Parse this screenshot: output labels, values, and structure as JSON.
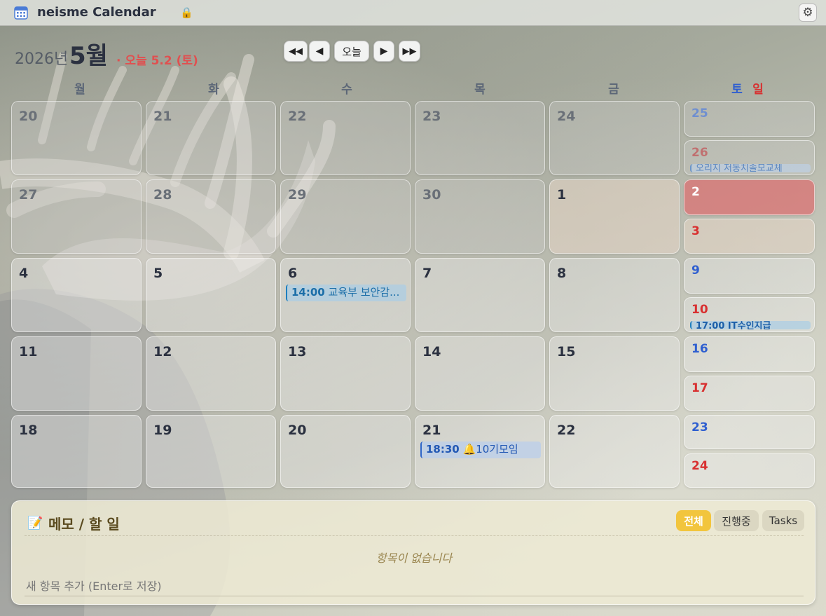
{
  "app": {
    "title": "neisme Calendar"
  },
  "header": {
    "year": "2026년",
    "month": "5월",
    "today": "· 오늘 5.2 (토)"
  },
  "nav": {
    "prev_year": "◀◀",
    "prev": "◀",
    "today_btn": "오늘",
    "next": "▶",
    "next_year": "▶▶"
  },
  "weekdays": {
    "mon": "월",
    "tue": "화",
    "wed": "수",
    "thu": "목",
    "fri": "금",
    "sat": "토",
    "sun": "일"
  },
  "colors": {
    "today_cell": "#d87878",
    "saturday": "#2f5fd0",
    "sunday": "#d83030",
    "event_border": "#1e7fbf",
    "filter_active": "#f2c53d"
  },
  "weeks": [
    {
      "days": [
        "20",
        "21",
        "22",
        "23",
        "24"
      ],
      "sat": "25",
      "sun": "26",
      "sun_event": "오리지 저동치솔모교체"
    },
    {
      "days": [
        "27",
        "28",
        "29",
        "30",
        "1"
      ],
      "sat": "2",
      "sun": "3"
    },
    {
      "days": [
        "4",
        "5",
        "6",
        "7",
        "8"
      ],
      "sat": "9",
      "sun": "10",
      "sun_event": "17:00 IT수인지급"
    },
    {
      "days": [
        "11",
        "12",
        "13",
        "14",
        "15"
      ],
      "sat": "16",
      "sun": "17"
    },
    {
      "days": [
        "18",
        "19",
        "20",
        "21",
        "22"
      ],
      "sat": "23",
      "sun": "24"
    }
  ],
  "events": {
    "wed_6": {
      "time": "14:00",
      "title": "교육부 보안감..."
    },
    "thu_21": {
      "time": "18:30",
      "icon": "🔔",
      "title": "10기모임"
    }
  },
  "memo": {
    "icon": "📝",
    "title": "메모 / 할 일",
    "filters": [
      "전체",
      "진행중",
      "Tasks"
    ],
    "active_filter": "전체",
    "empty": "항목이 없습니다",
    "placeholder": "새 항목 추가 (Enter로 저장)"
  }
}
